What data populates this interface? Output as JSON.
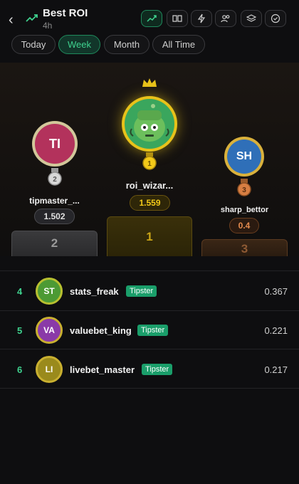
{
  "header": {
    "title": "Best ROI",
    "subtitle": "4h",
    "icons": [
      "back-chevron-icon",
      "trending-up-icon",
      "book-icon",
      "lightning-icon",
      "users-icon",
      "layers-icon",
      "check-circle-icon"
    ]
  },
  "tabs": [
    {
      "label": "Today",
      "active": false
    },
    {
      "label": "Week",
      "active": true
    },
    {
      "label": "Month",
      "active": false
    },
    {
      "label": "All Time",
      "active": false
    }
  ],
  "podium": {
    "first": {
      "initials": "",
      "name": "roi_wizar...",
      "score": "1.559",
      "rank": "1",
      "medal": "1"
    },
    "second": {
      "initials": "TI",
      "name": "tipmaster_...",
      "score": "1.502",
      "rank": "2",
      "medal": "2"
    },
    "third": {
      "initials": "SH",
      "name": "sharp_bettor",
      "score": "0.4",
      "rank": "3",
      "medal": "3"
    }
  },
  "list": [
    {
      "rank": "4",
      "initials": "ST",
      "name": "stats_freak",
      "badge": "Tipster",
      "score": "0.367"
    },
    {
      "rank": "5",
      "initials": "VA",
      "name": "valuebet_king",
      "badge": "Tipster",
      "score": "0.221"
    },
    {
      "rank": "6",
      "initials": "LI",
      "name": "livebet_master",
      "badge": "Tipster",
      "score": "0.217"
    }
  ],
  "colors": {
    "accent": "#3fd28f",
    "gold": "#e8c21a",
    "silver": "#c9c9c9",
    "bronze": "#d77e42",
    "badge": "#1a9e6a"
  }
}
